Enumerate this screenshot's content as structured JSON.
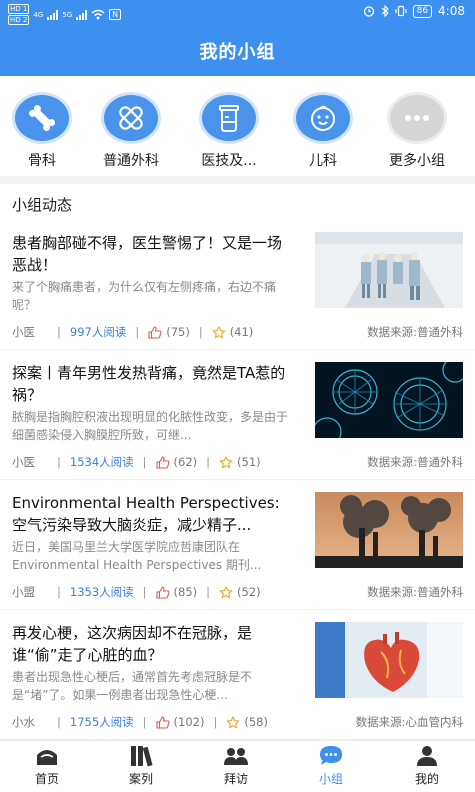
{
  "status_bar": {
    "hd1": "HD 1",
    "hd2": "HD 2",
    "net1": "4G",
    "net2": "5G",
    "nfc": "N",
    "battery": "86",
    "time": "4:08"
  },
  "header": {
    "title": "我的小组"
  },
  "groups": [
    {
      "label": "骨科",
      "icon": "bone-icon"
    },
    {
      "label": "普通外科",
      "icon": "bandage-icon"
    },
    {
      "label": "医技及...",
      "icon": "lab-jar-icon"
    },
    {
      "label": "儿科",
      "icon": "baby-icon"
    },
    {
      "label": "更多小组",
      "icon": "more-dots-icon"
    }
  ],
  "section": {
    "title": "小组动态"
  },
  "posts": [
    {
      "title": "患者胸部碰不得，医生警惕了！又是一场恶战！",
      "desc": "来了个胸痛患者，为什么仅有左侧疼痛，右边不痛呢？",
      "author": "小医",
      "reads": "997人阅读",
      "likes": "(75)",
      "favs": "(41)",
      "source": "数据来源:普通外科",
      "image": "hospital-corridor"
    },
    {
      "title": "探案丨青年男性发热背痛，竟然是TA惹的祸？",
      "desc": "脓胸是指胸腔积液出现明显的化脓性改变，多是由于细菌感染侵入胸膜腔所致，可继...",
      "author": "小医",
      "reads": "1534人阅读",
      "likes": "(62)",
      "favs": "(51)",
      "source": "数据来源:普通外科",
      "image": "bacteria"
    },
    {
      "title": "Environmental Health Perspectives: 空气污染导致大脑炎症，减少精子...",
      "desc": "近日，美国马里兰大学医学院应哲康团队在Environmental Health Perspectives 期刊...",
      "author": "小盟",
      "reads": "1353人阅读",
      "likes": "(85)",
      "favs": "(52)",
      "source": "数据来源:普通外科",
      "image": "smoke-pollution"
    },
    {
      "title": "再发心梗，这次病因却不在冠脉，是谁“偷”走了心脏的血？",
      "desc": "患者出现急性心梗后，通常首先考虑冠脉是不是“堵”了。如果一例患者出现急性心梗...",
      "author": "小水",
      "reads": "1755人阅读",
      "likes": "(102)",
      "favs": "(58)",
      "source": "数据来源:心血管内科",
      "image": "heart-model"
    }
  ],
  "tabs": [
    {
      "label": "首页",
      "icon": "home-icon"
    },
    {
      "label": "案列",
      "icon": "books-icon"
    },
    {
      "label": "拜访",
      "icon": "people-icon"
    },
    {
      "label": "小组",
      "icon": "chat-bubble-icon",
      "active": true
    },
    {
      "label": "我的",
      "icon": "person-icon"
    }
  ],
  "colors": {
    "brand": "#3d8ff0",
    "icon_bg": "#4a93ea",
    "read_count": "#3d7fd6",
    "like": "#e05a4f",
    "fav": "#e8a62a"
  }
}
